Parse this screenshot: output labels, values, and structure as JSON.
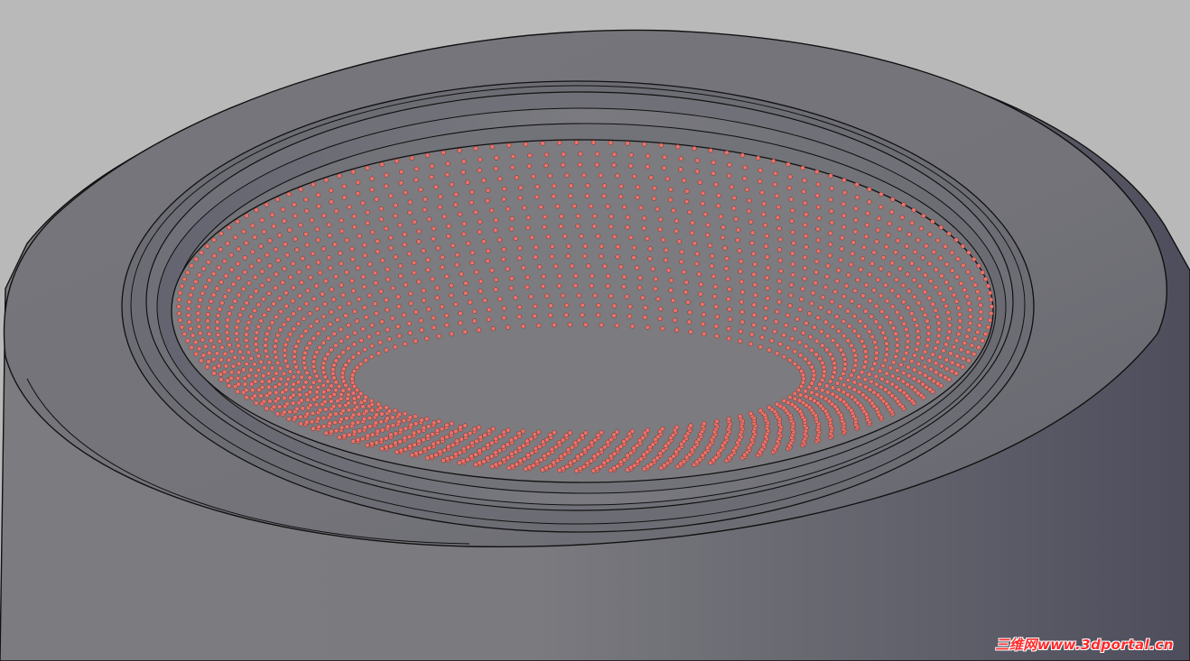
{
  "viewport": {
    "background_color": "#b9b9b9",
    "model_colors": {
      "body": "#6f6f78",
      "edge": "#111111",
      "thread": "#e8736a",
      "thread_dark": "#7a2f2a"
    }
  },
  "model": {
    "thread_rows": 19
  },
  "watermark": {
    "text": "三维网www.3dportal.cn"
  }
}
